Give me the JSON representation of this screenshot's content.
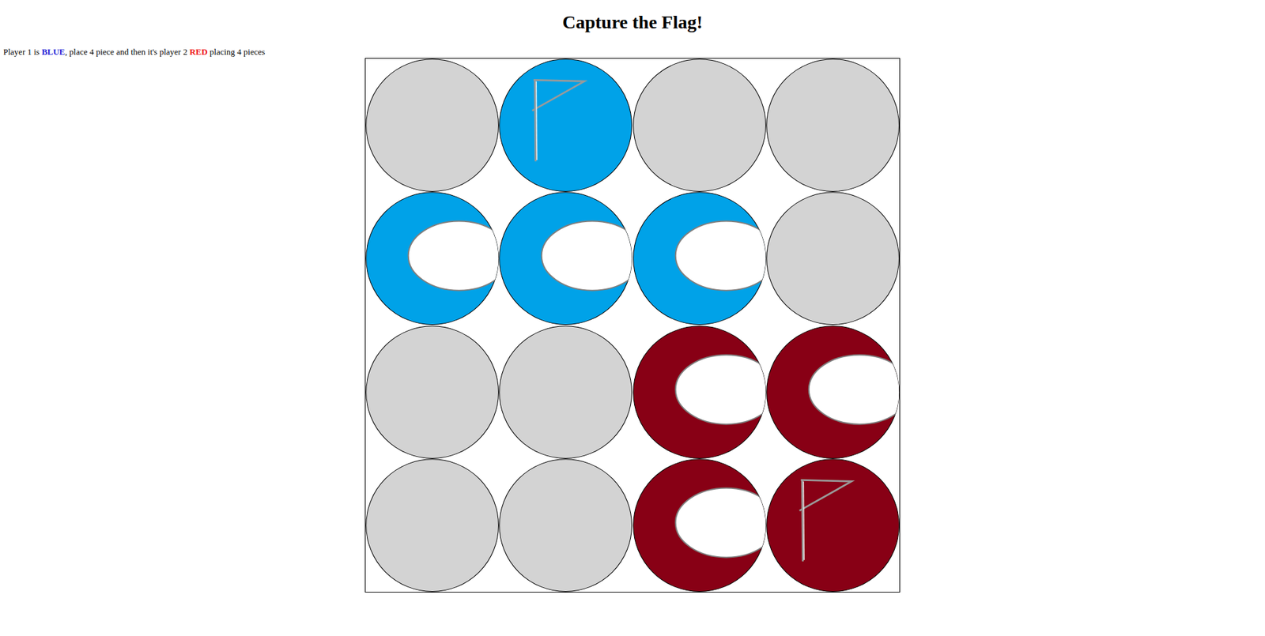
{
  "title": "Capture the Flag!",
  "instructions": [
    {
      "text": "Player 1 is ",
      "bold": false,
      "color": "#000000"
    },
    {
      "text": "BLUE",
      "bold": true,
      "color": "#1f1fd6"
    },
    {
      "text": ", place 4 piece and then it's player 2 ",
      "bold": false,
      "color": "#000000"
    },
    {
      "text": "RED",
      "bold": true,
      "color": "#ee1111"
    },
    {
      "text": " placing 4 pieces",
      "bold": false,
      "color": "#000000"
    }
  ],
  "board": [
    [
      {
        "kind": "empty",
        "color": "#d3d3d3"
      },
      {
        "kind": "flag",
        "color": "#00a2e8"
      },
      {
        "kind": "empty",
        "color": "#d3d3d3"
      },
      {
        "kind": "empty",
        "color": "#d3d3d3"
      }
    ],
    [
      {
        "kind": "piece",
        "color": "#00a2e8"
      },
      {
        "kind": "piece",
        "color": "#00a2e8"
      },
      {
        "kind": "piece",
        "color": "#00a2e8"
      },
      {
        "kind": "empty",
        "color": "#d3d3d3"
      }
    ],
    [
      {
        "kind": "empty",
        "color": "#d3d3d3"
      },
      {
        "kind": "empty",
        "color": "#d3d3d3"
      },
      {
        "kind": "piece",
        "color": "#880015"
      },
      {
        "kind": "piece",
        "color": "#880015"
      }
    ],
    [
      {
        "kind": "empty",
        "color": "#d3d3d3"
      },
      {
        "kind": "empty",
        "color": "#d3d3d3"
      },
      {
        "kind": "piece",
        "color": "#880015"
      },
      {
        "kind": "flag",
        "color": "#880015"
      }
    ]
  ]
}
